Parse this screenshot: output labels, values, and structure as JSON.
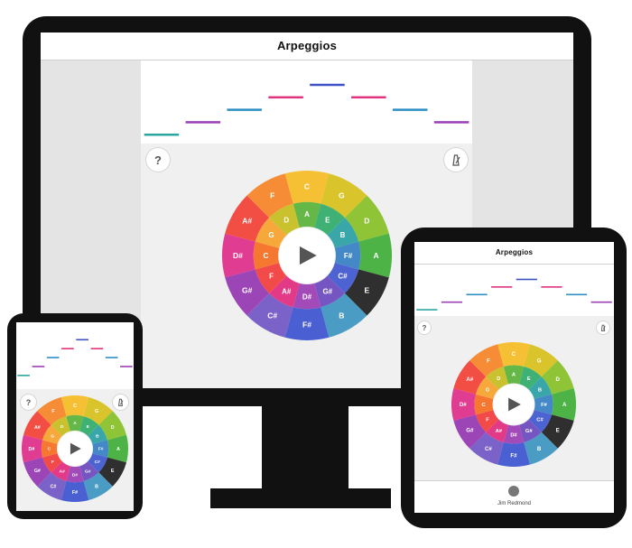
{
  "app": {
    "title": "Arpeggios",
    "help_label": "?",
    "metronome_icon": "metronome-icon",
    "play_icon": "play-icon"
  },
  "wheel": {
    "outer_notes": [
      "C",
      "G",
      "D",
      "A",
      "E",
      "B",
      "F#",
      "C#",
      "G#",
      "D#",
      "A#",
      "F"
    ],
    "outer_colors": [
      "#f6c035",
      "#d9c42b",
      "#8ec435",
      "#4db347",
      "#2f2f2f",
      "#4a9cc4",
      "#4a5fd1",
      "#7b62c8",
      "#9b45b6",
      "#e03c91",
      "#f24e44",
      "#f68c35"
    ],
    "inner_notes": [
      "A",
      "E",
      "B",
      "F#",
      "C#",
      "G#",
      "D#",
      "A#",
      "F",
      "C",
      "G",
      "D"
    ],
    "inner_colors": [
      "#65b848",
      "#40b174",
      "#39a6aa",
      "#4488c8",
      "#4d63d2",
      "#7555c2",
      "#a14ab8",
      "#e23a86",
      "#f24a49",
      "#f6772f",
      "#f6a93a",
      "#c9c12d"
    ]
  },
  "arpeggio_steps": [
    {
      "level": 0,
      "color": "#2aa6a0"
    },
    {
      "level": 1,
      "color": "#9b3fb5"
    },
    {
      "level": 2,
      "color": "#2f8ec4"
    },
    {
      "level": 3,
      "color": "#e0337e"
    },
    {
      "level": 4,
      "color": "#3e52c6"
    },
    {
      "level": 3,
      "color": "#e0337e"
    },
    {
      "level": 2,
      "color": "#2f8ec4"
    },
    {
      "level": 1,
      "color": "#9b3fb5"
    }
  ],
  "tablet": {
    "footer_name": "Jim Redmond"
  }
}
